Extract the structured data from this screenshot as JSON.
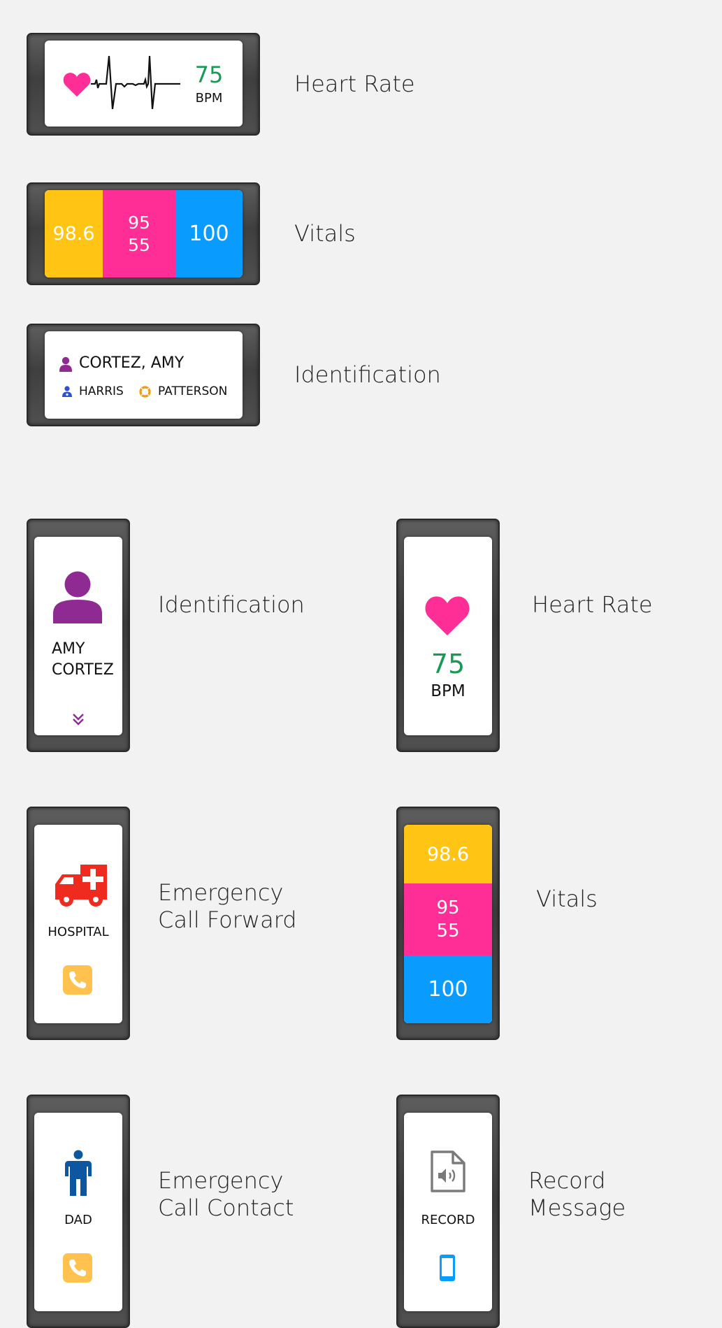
{
  "colors": {
    "yellow": "#ffc414",
    "pink": "#ff2d96",
    "blue": "#0a9bff",
    "green": "#169a55",
    "purple": "#8e2a92",
    "red": "#ee2b1e",
    "orange_call": "#ffc24e",
    "dark_blue": "#0c57a0",
    "device_frame": "#4a4a4a",
    "background": "#f2f2f2"
  },
  "landscape": {
    "heart_rate": {
      "label": "Heart Rate",
      "value": "75",
      "unit": "BPM",
      "icons": [
        "heart-icon",
        "ecg-waveform-icon"
      ]
    },
    "vitals": {
      "label": "Vitals",
      "temperature": "98.6",
      "bp_systolic": "95",
      "bp_diastolic": "55",
      "oxygen": "100"
    },
    "identification": {
      "label": "Identification",
      "patient_name": "CORTEZ, AMY",
      "doctor": "HARRIS",
      "nurse": "PATTERSON",
      "icons": [
        "person-icon",
        "doctor-icon",
        "lifebuoy-icon"
      ]
    }
  },
  "portrait": {
    "identification": {
      "label": "Identification",
      "first_name": "AMY",
      "last_name": "CORTEZ",
      "icons": [
        "person-icon",
        "double-chevron-down-icon"
      ]
    },
    "heart_rate": {
      "label": "Heart Rate",
      "value": "75",
      "unit": "BPM",
      "icons": [
        "heart-icon"
      ]
    },
    "emergency_forward": {
      "label": "Emergency\nCall Forward",
      "caption": "HOSPITAL",
      "icons": [
        "ambulance-icon",
        "phone-icon"
      ]
    },
    "vitals": {
      "label": "Vitals",
      "temperature": "98.6",
      "bp_systolic": "95",
      "bp_diastolic": "55",
      "oxygen": "100"
    },
    "emergency_contact": {
      "label": "Emergency\nCall Contact",
      "caption": "DAD",
      "icons": [
        "person-standing-icon",
        "phone-icon"
      ]
    },
    "record_message": {
      "label": "Record\nMessage",
      "caption": "RECORD",
      "icons": [
        "audio-file-icon",
        "mobile-phone-icon"
      ]
    }
  }
}
